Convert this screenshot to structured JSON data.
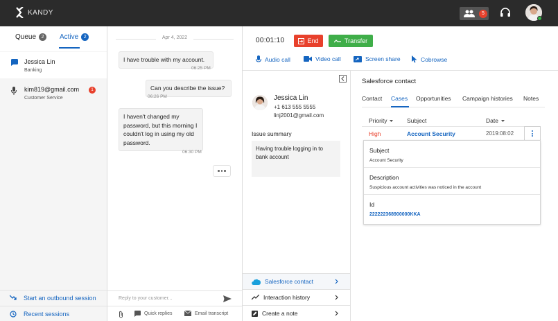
{
  "brand": {
    "logo_text": "KANDY"
  },
  "topbar": {
    "users_badge": "5"
  },
  "left_tabs": {
    "queue": {
      "label": "Queue",
      "count": "2"
    },
    "active": {
      "label": "Active",
      "count": "2"
    }
  },
  "sessions": [
    {
      "name": "Jessica Lin",
      "sub": "Banking"
    },
    {
      "name": "kim819@gmail.com",
      "sub": "Customer Service",
      "badge": "1"
    }
  ],
  "left_links": {
    "outbound": "Start an outbound session",
    "recent": "Recent sessions"
  },
  "chat": {
    "date": "Apr 4, 2022",
    "messages": [
      {
        "text": "I have trouble with my account.",
        "time": "06:25 PM"
      },
      {
        "text": "Can you describe the issue?",
        "time": "06:26 PM"
      },
      {
        "text_lines": [
          "I haven't changed my",
          "password, but this morning I",
          "couldn't log in using my old",
          "password."
        ],
        "time": "06:30 PM"
      }
    ],
    "reply_placeholder": "Reply to your customer...",
    "quick_replies": "Quick replies",
    "email_transcript": "Email transcript"
  },
  "call": {
    "timer": "00:01:10",
    "end_label": "End",
    "transfer_label": "Transfer",
    "audio": "Audio call",
    "video": "Video call",
    "screen": "Screen share",
    "cobrowse": "Cobrowse"
  },
  "contact": {
    "name": "Jessica Lin",
    "phone": "+1 613 555 5555",
    "email": "linj2001@gmail.com",
    "summary_label": "Issue summary",
    "summary_lines": [
      "Having trouble logging in to",
      "bank account"
    ],
    "links": {
      "salesforce": "Salesforce contact",
      "history": "Interaction history",
      "note": "Create a note"
    }
  },
  "salesforce": {
    "title": "Salesforce contact",
    "tabs": [
      "Contact",
      "Cases",
      "Opportunities",
      "Campaign histories",
      "Notes"
    ],
    "columns": {
      "priority": "Priority",
      "subject": "Subject",
      "date": "Date"
    },
    "row": {
      "priority": "High",
      "subject": "Account Security",
      "date": "2019:08:02"
    },
    "details": {
      "subject_label": "Subject",
      "subject_value": "Account Security",
      "description_label": "Description",
      "description_value": "Suspicious account activities was noticed in the account",
      "id_label": "Id",
      "id_value": "222222368900000KKA"
    }
  },
  "colors": {
    "accent": "#1565c0",
    "danger": "#e8412c",
    "success": "#3fae49",
    "topbar": "#2b2b2b"
  }
}
